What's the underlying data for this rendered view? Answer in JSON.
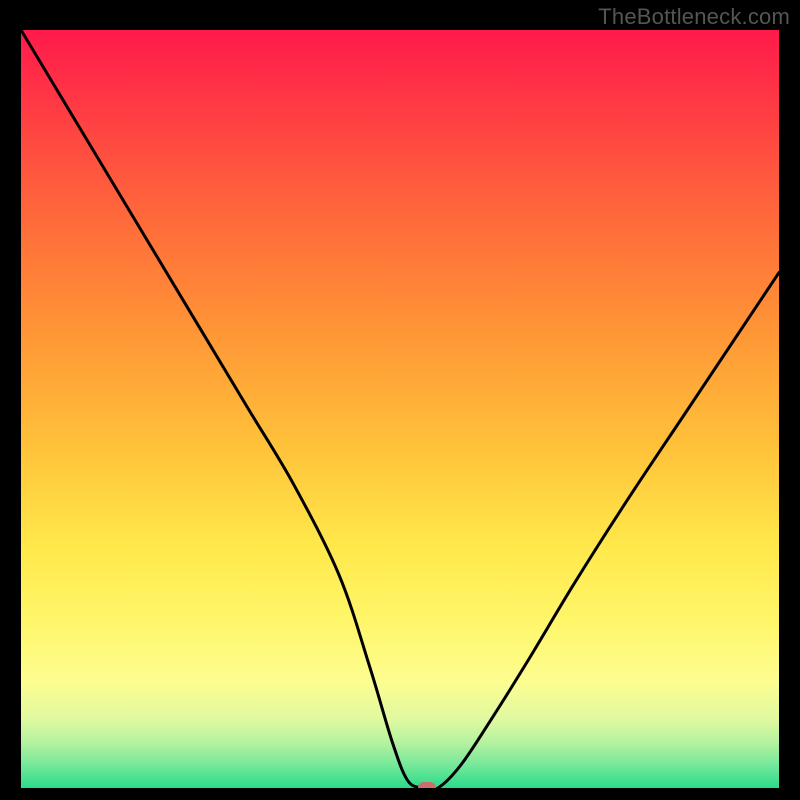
{
  "watermark": "TheBottleneck.com",
  "chart_data": {
    "type": "line",
    "title": "",
    "xlabel": "",
    "ylabel": "",
    "xlim": [
      0,
      100
    ],
    "ylim": [
      0,
      100
    ],
    "grid": false,
    "legend": false,
    "series": [
      {
        "name": "bottleneck-curve",
        "x": [
          0,
          6,
          12,
          18,
          24,
          30,
          36,
          42,
          46,
          49,
          51,
          53,
          55,
          58,
          62,
          67,
          73,
          80,
          88,
          96,
          100
        ],
        "values": [
          100,
          90,
          80,
          70,
          60,
          50,
          40,
          28,
          16,
          6,
          1,
          0,
          0,
          3,
          9,
          17,
          27,
          38,
          50,
          62,
          68
        ]
      }
    ],
    "marker": {
      "x": 53.5,
      "value": 0
    },
    "background_gradient": {
      "top": "#ff1a4b",
      "mid": "#ffe84a",
      "bottom": "#29db8b"
    }
  }
}
